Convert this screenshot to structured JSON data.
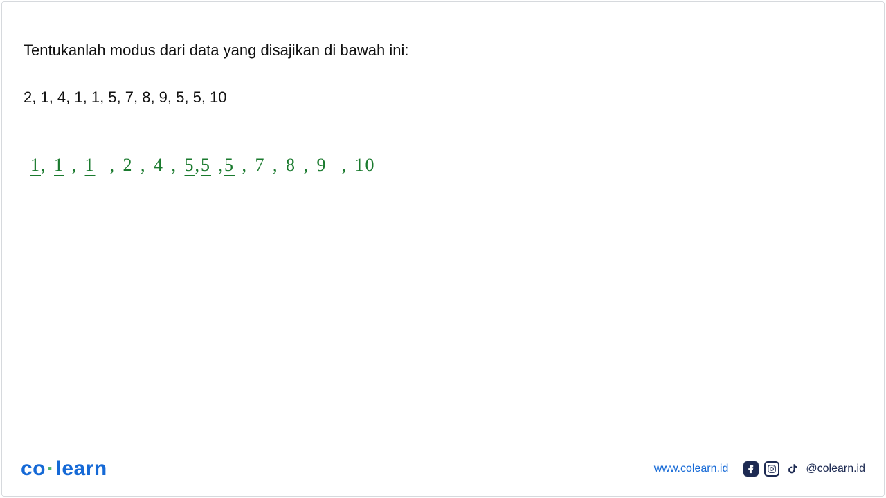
{
  "question": {
    "prompt": "Tentukanlah modus dari data yang disajikan di bawah ini:",
    "data_unsorted": "2, 1, 4, 1, 1, 5, 7, 8, 9, 5, 5, 10"
  },
  "work": {
    "sorted_sequence": {
      "n1": "1",
      "n2": "1",
      "n3": "1",
      "n4": "2",
      "n5": "4",
      "n6": "5",
      "n7": "5",
      "n8": "5",
      "n9": "7",
      "n10": "8",
      "n11": "9",
      "n12": "10"
    }
  },
  "brand": {
    "part1": "co",
    "dot": "·",
    "part2": "learn"
  },
  "footer": {
    "website": "www.colearn.id",
    "handle": "@colearn.id"
  },
  "icons": {
    "facebook": "facebook-icon",
    "instagram": "instagram-icon",
    "tiktok": "tiktok-icon"
  }
}
